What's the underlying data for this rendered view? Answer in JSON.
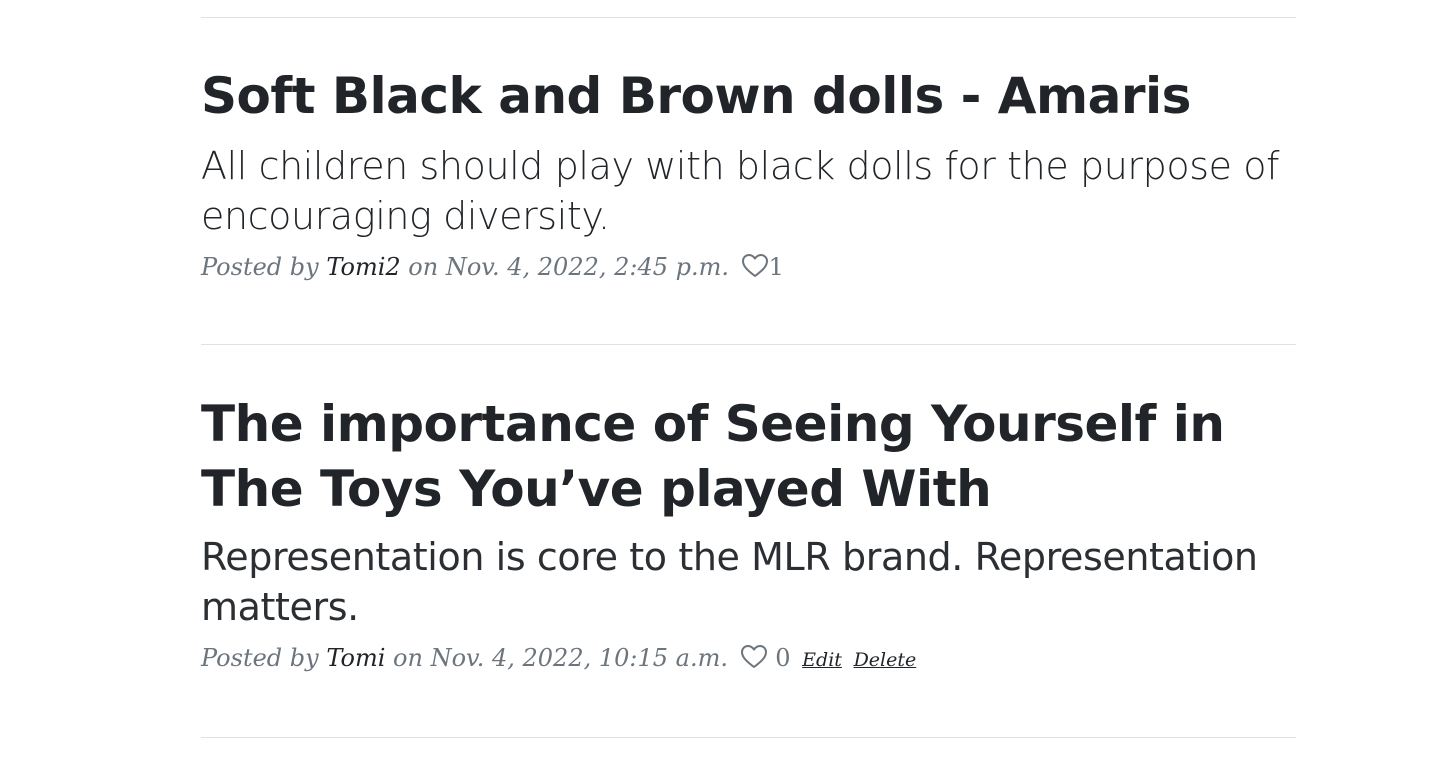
{
  "posts": [
    {
      "title": "Soft Black and Brown dolls - Amaris",
      "subtitle": "All children should play with black dolls for the purpose of encouraging diversity.",
      "meta_prefix": "Posted by",
      "author": "Tomi2",
      "meta_on": "on",
      "date": "Nov. 4, 2022, 2:45 p.m.",
      "likes": "1",
      "icon": "heart-outline-icon"
    },
    {
      "title": "The importance of Seeing Yourself in The Toys You’ve played With",
      "subtitle": "Representation is core to the MLR brand. Representation matters.",
      "meta_prefix": "Posted by",
      "author": "Tomi",
      "meta_on": "on",
      "date": "Nov. 4, 2022, 10:15 a.m.",
      "likes": "0",
      "icon": "heart-outline-icon",
      "edit_label": "Edit",
      "delete_label": "Delete"
    }
  ],
  "colors": {
    "text": "#212529",
    "muted": "#6c757d",
    "divider": "#dee2e6"
  }
}
